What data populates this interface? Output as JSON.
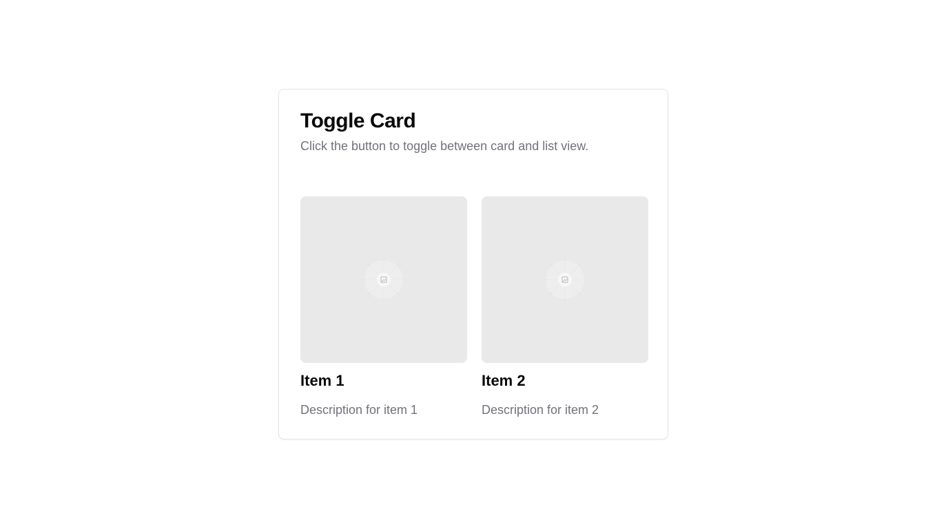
{
  "card": {
    "title": "Toggle Card",
    "description": "Click the button to toggle between card and list view."
  },
  "items": [
    {
      "title": "Item 1",
      "description": "Description for item 1",
      "image_icon": "image-placeholder-icon"
    },
    {
      "title": "Item 2",
      "description": "Description for item 2",
      "image_icon": "image-placeholder-icon"
    }
  ],
  "colors": {
    "title": "#09090b",
    "muted_text": "#71717a",
    "card_border": "#e4e4e7",
    "image_placeholder_bg": "#e9e9e9"
  }
}
